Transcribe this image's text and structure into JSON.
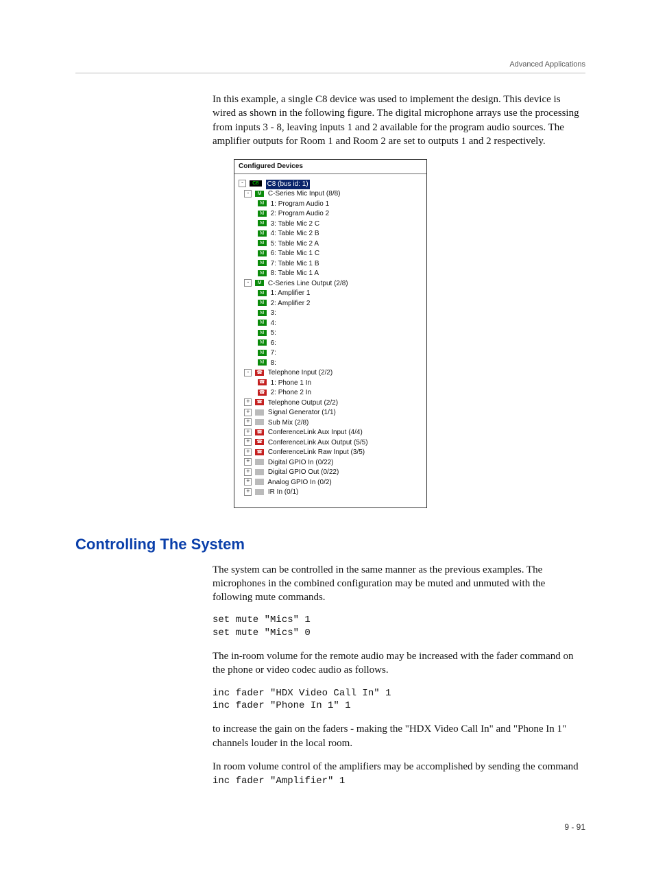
{
  "header": {
    "chapter": "Advanced Applications"
  },
  "intro_paragraph": "In this example, a single C8 device was used to implement the design. This device is wired as shown in the following figure. The digital microphone arrays use the processing from inputs 3 - 8, leaving inputs 1 and 2 available for the program audio sources. The amplifier outputs for Room 1 and Room 2 are set to outputs 1 and 2 respectively.",
  "tree": {
    "title": "Configured Devices",
    "root": "C8 (bus id: 1)",
    "groups": [
      {
        "label": "C-Series Mic Input (8/8)",
        "icon": "green",
        "expand": "-",
        "children": [
          "1: Program Audio 1",
          "2: Program Audio 2",
          "3: Table Mic 2 C",
          "4: Table Mic 2 B",
          "5: Table Mic 2 A",
          "6: Table Mic 1 C",
          "7: Table Mic 1 B",
          "8: Table Mic 1 A"
        ]
      },
      {
        "label": "C-Series Line Output (2/8)",
        "icon": "green",
        "expand": "-",
        "children": [
          "1: Amplifier 1",
          "2: Amplifier 2",
          "3:",
          "4:",
          "5:",
          "6:",
          "7:",
          "8:"
        ]
      },
      {
        "label": "Telephone Input (2/2)",
        "icon": "red",
        "expand": "-",
        "children": [
          "1: Phone 1 In",
          "2: Phone 2 In"
        ]
      },
      {
        "label": "Telephone Output (2/2)",
        "icon": "red",
        "expand": "+",
        "children": []
      },
      {
        "label": "Signal Generator (1/1)",
        "icon": "grey",
        "expand": "+",
        "children": []
      },
      {
        "label": "Sub Mix (2/8)",
        "icon": "grey",
        "expand": "+",
        "children": []
      },
      {
        "label": "ConferenceLink Aux Input (4/4)",
        "icon": "red",
        "expand": "+",
        "children": []
      },
      {
        "label": "ConferenceLink Aux Output (5/5)",
        "icon": "red",
        "expand": "+",
        "children": []
      },
      {
        "label": "ConferenceLink Raw Input (3/5)",
        "icon": "red",
        "expand": "+",
        "children": []
      },
      {
        "label": "Digital GPIO In (0/22)",
        "icon": "grey",
        "expand": "+",
        "children": []
      },
      {
        "label": "Digital GPIO Out (0/22)",
        "icon": "grey",
        "expand": "+",
        "children": []
      },
      {
        "label": "Analog GPIO In (0/2)",
        "icon": "grey",
        "expand": "+",
        "children": []
      },
      {
        "label": "IR In (0/1)",
        "icon": "grey",
        "expand": "+",
        "children": []
      }
    ]
  },
  "section": {
    "heading": "Controlling The System",
    "para1": "The system can be controlled in the same manner as the previous examples. The microphones in the combined configuration may be muted and unmuted with the following mute commands.",
    "code1": "set mute \"Mics\" 1\nset mute \"Mics\" 0",
    "para2": "The in-room volume for the remote audio may be increased with the fader command on the phone or video codec audio as follows.",
    "code2": "inc fader \"HDX Video Call In\" 1\ninc fader \"Phone In 1\" 1",
    "para3": "to increase the gain on the faders - making the \"HDX Video Call In\" and \"Phone In 1\" channels louder in the local room.",
    "para4": "In room volume control of the amplifiers may be accomplished by sending the command",
    "code3": "inc fader \"Amplifier\" 1"
  },
  "footer": {
    "page_number": "9 - 91"
  }
}
